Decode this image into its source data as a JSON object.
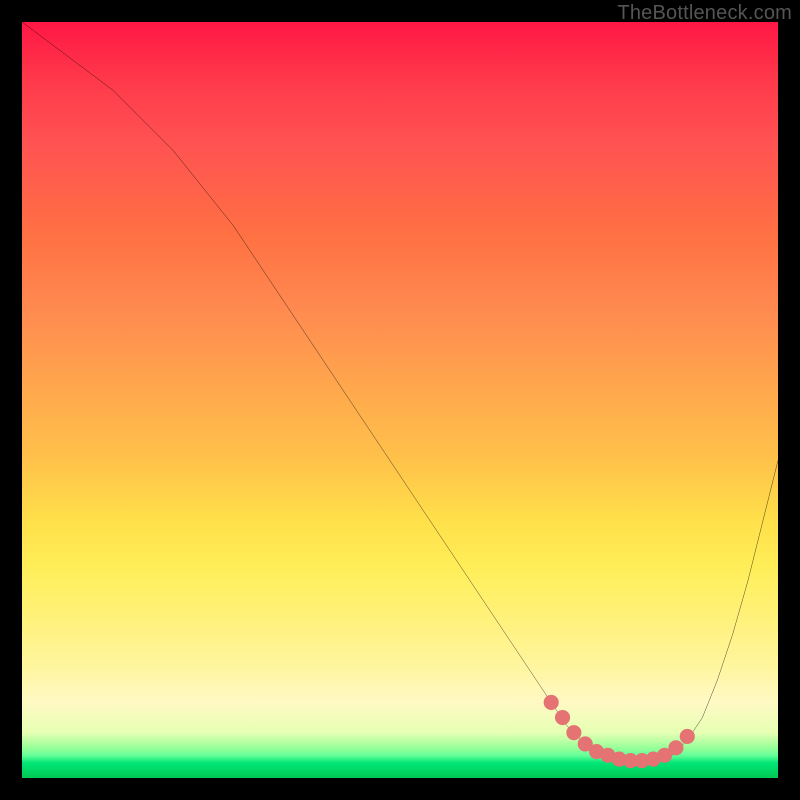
{
  "watermark": "TheBottleneck.com",
  "colors": {
    "curve": "#000000",
    "marker_fill": "#e57373",
    "marker_stroke": "#e57373",
    "frame_bg": "#000000"
  },
  "chart_data": {
    "type": "line",
    "title": "",
    "xlabel": "",
    "ylabel": "",
    "xlim": [
      0,
      100
    ],
    "ylim": [
      0,
      100
    ],
    "grid": false,
    "series": [
      {
        "name": "bottleneck-curve",
        "x": [
          0,
          4,
          8,
          12,
          16,
          20,
          24,
          28,
          32,
          36,
          40,
          44,
          48,
          52,
          56,
          60,
          64,
          68,
          70,
          72,
          74,
          76,
          78,
          80,
          82,
          84,
          86,
          88,
          90,
          92,
          94,
          96,
          98,
          100
        ],
        "values": [
          100,
          97,
          94,
          91,
          87,
          83,
          78,
          73,
          67,
          61,
          55,
          49,
          43,
          37,
          31,
          25,
          19,
          13,
          10,
          7,
          5,
          3,
          2.3,
          2,
          2,
          2.3,
          3,
          5,
          8,
          13,
          19,
          26,
          34,
          42
        ]
      }
    ],
    "markers": {
      "name": "optimal-range-markers",
      "x": [
        70,
        71.5,
        73,
        74.5,
        76,
        77.5,
        79,
        80.5,
        82,
        83.5,
        85,
        86.5,
        88
      ],
      "values": [
        10,
        8,
        6,
        4.5,
        3.5,
        3,
        2.5,
        2.3,
        2.3,
        2.5,
        3,
        4,
        5.5
      ]
    }
  }
}
